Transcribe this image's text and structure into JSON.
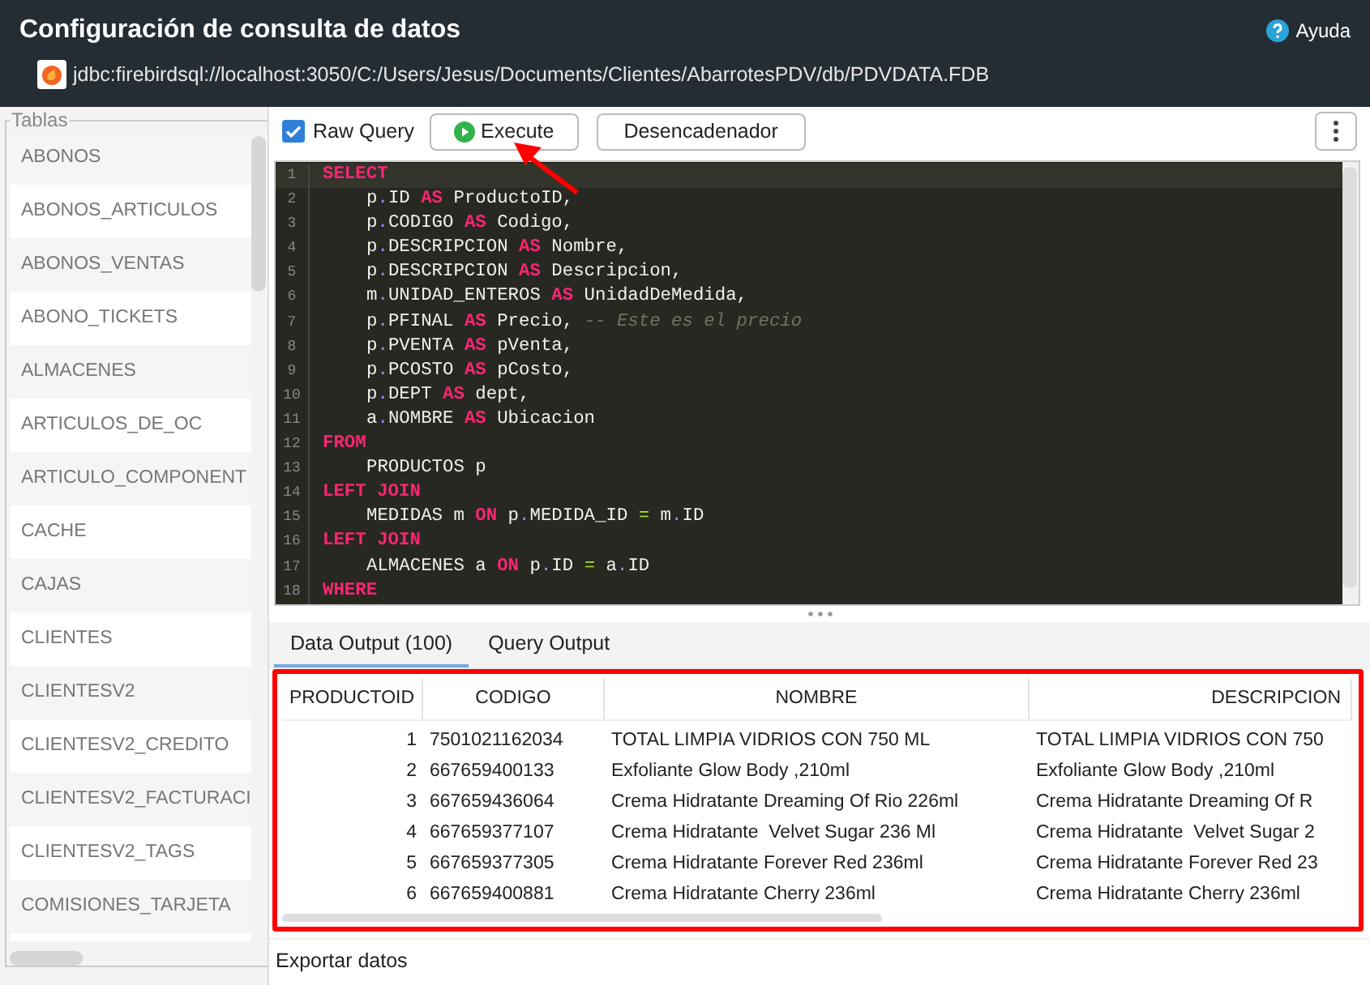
{
  "header": {
    "title": "Configuración de consulta de datos",
    "connection": "jdbc:firebirdsql://localhost:3050/C:/Users/Jesus/Documents/Clientes/AbarrotesPDV/db/PDVDATA.FDB",
    "help": "Ayuda"
  },
  "toolbar": {
    "raw_query": {
      "label": "Raw Query",
      "checked": true
    },
    "buttons": [
      {
        "label": "Execute",
        "kind": "run"
      },
      {
        "label": "Desencadenador",
        "kind": "plain"
      }
    ]
  },
  "sidebar": {
    "legend": "Tablas",
    "items": [
      "ABONOS",
      "ABONOS_ARTICULOS",
      "ABONOS_VENTAS",
      "ABONO_TICKETS",
      "ALMACENES",
      "ARTICULOS_DE_OC",
      "ARTICULO_COMPONENT",
      "CACHE",
      "CAJAS",
      "CLIENTES",
      "CLIENTESV2",
      "CLIENTESV2_CREDITO",
      "CLIENTESV2_FACTURACI",
      "CLIENTESV2_TAGS",
      "COMISIONES_TARJETA"
    ]
  },
  "editor": {
    "lines": [
      {
        "number": "1",
        "indented": false,
        "tokens": [
          {
            "t": "SELECT",
            "kind": "kw"
          }
        ]
      },
      {
        "number": "2",
        "indented": true,
        "tokens": [
          {
            "t": "p",
            "kind": "tx"
          },
          {
            "t": ".",
            "kind": "dot"
          },
          {
            "t": "ID ",
            "kind": "tx"
          },
          {
            "t": "AS",
            "kind": "kw"
          },
          {
            "t": " ProductoID,",
            "kind": "tx"
          }
        ]
      },
      {
        "number": "3",
        "indented": true,
        "tokens": [
          {
            "t": "p",
            "kind": "tx"
          },
          {
            "t": ".",
            "kind": "dot"
          },
          {
            "t": "CODIGO ",
            "kind": "tx"
          },
          {
            "t": "AS",
            "kind": "kw"
          },
          {
            "t": " Codigo,",
            "kind": "tx"
          }
        ]
      },
      {
        "number": "4",
        "indented": true,
        "tokens": [
          {
            "t": "p",
            "kind": "tx"
          },
          {
            "t": ".",
            "kind": "dot"
          },
          {
            "t": "DESCRIPCION ",
            "kind": "tx"
          },
          {
            "t": "AS",
            "kind": "kw"
          },
          {
            "t": " Nombre,",
            "kind": "tx"
          }
        ]
      },
      {
        "number": "5",
        "indented": true,
        "tokens": [
          {
            "t": "p",
            "kind": "tx"
          },
          {
            "t": ".",
            "kind": "dot"
          },
          {
            "t": "DESCRIPCION ",
            "kind": "tx"
          },
          {
            "t": "AS",
            "kind": "kw"
          },
          {
            "t": " Descripcion,",
            "kind": "tx"
          }
        ]
      },
      {
        "number": "6",
        "indented": true,
        "tokens": [
          {
            "t": "m",
            "kind": "tx"
          },
          {
            "t": ".",
            "kind": "dot"
          },
          {
            "t": "UNIDAD_ENTEROS ",
            "kind": "tx"
          },
          {
            "t": "AS",
            "kind": "kw"
          },
          {
            "t": " UnidadDeMedida,",
            "kind": "tx"
          }
        ]
      },
      {
        "number": "7",
        "indented": true,
        "tokens": [
          {
            "t": "p",
            "kind": "tx"
          },
          {
            "t": ".",
            "kind": "dot"
          },
          {
            "t": "PFINAL ",
            "kind": "tx"
          },
          {
            "t": "AS",
            "kind": "kw"
          },
          {
            "t": " Precio, ",
            "kind": "tx"
          },
          {
            "t": "-- Este es el precio",
            "kind": "cm"
          }
        ]
      },
      {
        "number": "8",
        "indented": true,
        "tokens": [
          {
            "t": "p",
            "kind": "tx"
          },
          {
            "t": ".",
            "kind": "dot"
          },
          {
            "t": "PVENTA ",
            "kind": "tx"
          },
          {
            "t": "AS",
            "kind": "kw"
          },
          {
            "t": " pVenta,",
            "kind": "tx"
          }
        ]
      },
      {
        "number": "9",
        "indented": true,
        "tokens": [
          {
            "t": "p",
            "kind": "tx"
          },
          {
            "t": ".",
            "kind": "dot"
          },
          {
            "t": "PCOSTO ",
            "kind": "tx"
          },
          {
            "t": "AS",
            "kind": "kw"
          },
          {
            "t": " pCosto,",
            "kind": "tx"
          }
        ]
      },
      {
        "number": "10",
        "indented": true,
        "tokens": [
          {
            "t": "p",
            "kind": "tx"
          },
          {
            "t": ".",
            "kind": "dot"
          },
          {
            "t": "DEPT ",
            "kind": "tx"
          },
          {
            "t": "AS",
            "kind": "kw"
          },
          {
            "t": " dept,",
            "kind": "tx"
          }
        ]
      },
      {
        "number": "11",
        "indented": true,
        "tokens": [
          {
            "t": "a",
            "kind": "tx"
          },
          {
            "t": ".",
            "kind": "dot"
          },
          {
            "t": "NOMBRE ",
            "kind": "tx"
          },
          {
            "t": "AS",
            "kind": "kw"
          },
          {
            "t": " Ubicacion",
            "kind": "tx"
          }
        ]
      },
      {
        "number": "12",
        "indented": false,
        "tokens": [
          {
            "t": "FROM",
            "kind": "kw"
          }
        ]
      },
      {
        "number": "13",
        "indented": true,
        "tokens": [
          {
            "t": "PRODUCTOS p",
            "kind": "tx"
          }
        ]
      },
      {
        "number": "14",
        "indented": false,
        "tokens": [
          {
            "t": "LEFT JOIN",
            "kind": "kw"
          }
        ]
      },
      {
        "number": "15",
        "indented": true,
        "tokens": [
          {
            "t": "MEDIDAS m ",
            "kind": "tx"
          },
          {
            "t": "ON",
            "kind": "kw"
          },
          {
            "t": " p",
            "kind": "tx"
          },
          {
            "t": ".",
            "kind": "dot"
          },
          {
            "t": "MEDIDA_ID ",
            "kind": "tx"
          },
          {
            "t": "=",
            "kind": "op"
          },
          {
            "t": " m",
            "kind": "tx"
          },
          {
            "t": ".",
            "kind": "dot"
          },
          {
            "t": "ID",
            "kind": "tx"
          }
        ]
      },
      {
        "number": "16",
        "indented": false,
        "tokens": [
          {
            "t": "LEFT JOIN",
            "kind": "kw"
          }
        ]
      },
      {
        "number": "17",
        "indented": true,
        "tokens": [
          {
            "t": "ALMACENES a ",
            "kind": "tx"
          },
          {
            "t": "ON",
            "kind": "kw"
          },
          {
            "t": " p",
            "kind": "tx"
          },
          {
            "t": ".",
            "kind": "dot"
          },
          {
            "t": "ID ",
            "kind": "tx"
          },
          {
            "t": "=",
            "kind": "op"
          },
          {
            "t": " a",
            "kind": "tx"
          },
          {
            "t": ".",
            "kind": "dot"
          },
          {
            "t": "ID",
            "kind": "tx"
          }
        ]
      },
      {
        "number": "18",
        "indented": false,
        "tokens": [
          {
            "t": "WHERE",
            "kind": "kw"
          }
        ]
      }
    ]
  },
  "output": {
    "tabs": [
      {
        "label": "Data Output (100)",
        "selected": true
      },
      {
        "label": "Query Output",
        "selected": false
      }
    ],
    "table": {
      "columns": [
        "PRODUCTOID",
        "CODIGO",
        "NOMBRE",
        "DESCRIPCION"
      ],
      "rows": [
        [
          "1",
          "7501021162034",
          "TOTAL LIMPIA VIDRIOS CON 750 ML",
          "TOTAL LIMPIA VIDRIOS CON 750"
        ],
        [
          "2",
          "667659400133",
          "Exfoliante Glow Body ,210ml",
          "Exfoliante Glow Body ,210ml"
        ],
        [
          "3",
          "667659436064",
          "Crema Hidratante Dreaming Of Rio 226ml",
          "Crema Hidratante Dreaming Of R"
        ],
        [
          "4",
          "667659377107",
          "Crema Hidratante  Velvet Sugar 236 Ml",
          "Crema Hidratante  Velvet Sugar 2"
        ],
        [
          "5",
          "667659377305",
          "Crema Hidratante Forever Red 236ml",
          "Crema Hidratante Forever Red 23"
        ],
        [
          "6",
          "667659400881",
          "Crema Hidratante Cherry 236ml",
          "Crema Hidratante Cherry 236ml"
        ]
      ]
    }
  },
  "footer": {
    "export": "Exportar datos"
  }
}
